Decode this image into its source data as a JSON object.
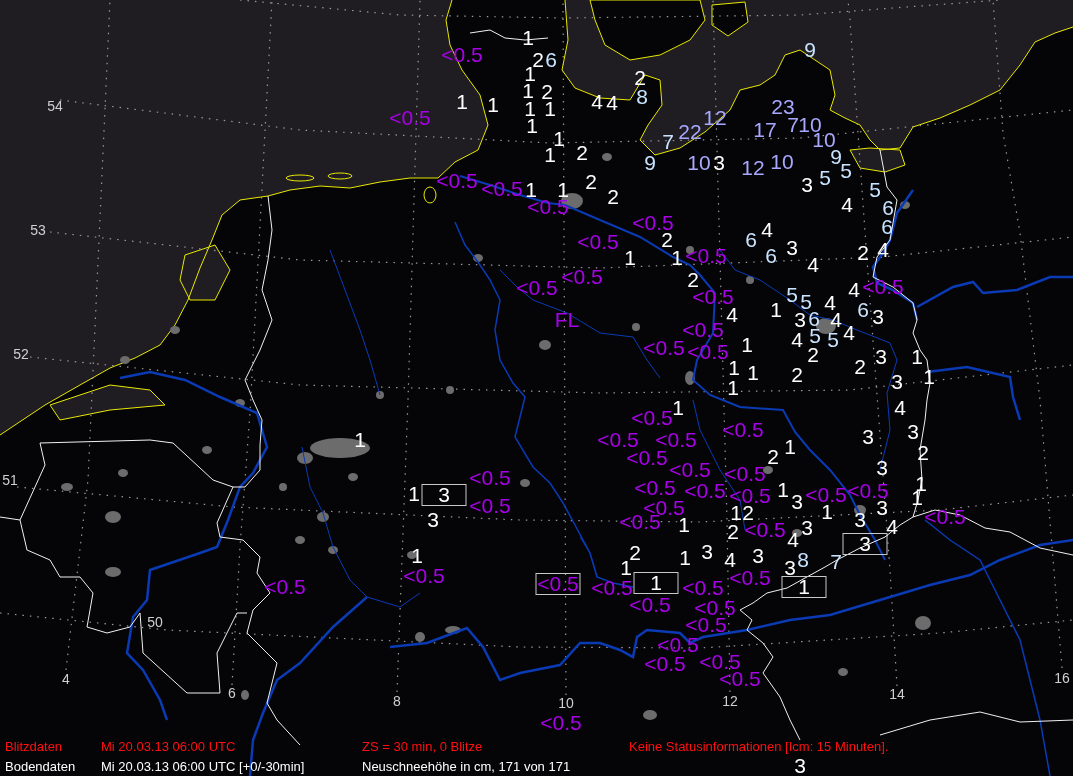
{
  "map": {
    "latitude_labels": [
      "54",
      "53",
      "52",
      "51",
      "50"
    ],
    "longitude_labels": [
      "4",
      "6",
      "8",
      "10",
      "12",
      "14",
      "16"
    ],
    "marker": "FL",
    "stations": [
      {
        "text": "1",
        "color": "#ffffff",
        "boxed": false
      },
      {
        "text": "<0.5",
        "color": "#a800e8",
        "boxed": false
      },
      {
        "text": "2",
        "color": "#ffffff",
        "boxed": false
      },
      {
        "text": "6",
        "color": "#c8e4ff",
        "boxed": false
      },
      {
        "text": "9",
        "color": "#c8e4ff",
        "boxed": false
      },
      {
        "text": "1",
        "color": "#ffffff",
        "boxed": false
      },
      {
        "text": "2",
        "color": "#ffffff",
        "boxed": false
      },
      {
        "text": "1",
        "color": "#ffffff",
        "boxed": false
      },
      {
        "text": "2",
        "color": "#ffffff",
        "boxed": false
      },
      {
        "text": "1",
        "color": "#ffffff",
        "boxed": false
      },
      {
        "text": "1",
        "color": "#ffffff",
        "boxed": false
      },
      {
        "text": "1",
        "color": "#ffffff",
        "boxed": false
      },
      {
        "text": "1",
        "color": "#ffffff",
        "boxed": false
      },
      {
        "text": "4",
        "color": "#ffffff",
        "boxed": false
      },
      {
        "text": "4",
        "color": "#ffffff",
        "boxed": false
      },
      {
        "text": "8",
        "color": "#c8e4ff",
        "boxed": false
      },
      {
        "text": "23",
        "color": "#a8a8ff",
        "boxed": false
      },
      {
        "text": "<0.5",
        "color": "#a800e8",
        "boxed": false
      },
      {
        "text": "1",
        "color": "#ffffff",
        "boxed": false
      },
      {
        "text": "1",
        "color": "#ffffff",
        "boxed": false
      },
      {
        "text": "7",
        "color": "#c8e4ff",
        "boxed": false
      },
      {
        "text": "22",
        "color": "#a8a8ff",
        "boxed": false
      },
      {
        "text": "12",
        "color": "#a8a8ff",
        "boxed": false
      },
      {
        "text": "17",
        "color": "#a8a8ff",
        "boxed": false
      },
      {
        "text": "7",
        "color": "#a8a8ff",
        "boxed": false
      },
      {
        "text": "10",
        "color": "#a8a8ff",
        "boxed": false
      },
      {
        "text": "10",
        "color": "#a8a8ff",
        "boxed": false
      },
      {
        "text": "1",
        "color": "#ffffff",
        "boxed": false
      },
      {
        "text": "2",
        "color": "#ffffff",
        "boxed": false
      },
      {
        "text": "9",
        "color": "#c8e4ff",
        "boxed": false
      },
      {
        "text": "10",
        "color": "#a8a8ff",
        "boxed": false
      },
      {
        "text": "3",
        "color": "#ffffff",
        "boxed": false
      },
      {
        "text": "12",
        "color": "#a8a8ff",
        "boxed": false
      },
      {
        "text": "10",
        "color": "#a8a8ff",
        "boxed": false
      },
      {
        "text": "9",
        "color": "#c8e4ff",
        "boxed": false
      },
      {
        "text": "5",
        "color": "#c8e4ff",
        "boxed": false
      },
      {
        "text": "<0.5",
        "color": "#a800e8",
        "boxed": false
      },
      {
        "text": "<0.5",
        "color": "#a800e8",
        "boxed": false
      },
      {
        "text": "1",
        "color": "#ffffff",
        "boxed": false
      },
      {
        "text": "1",
        "color": "#ffffff",
        "boxed": false
      },
      {
        "text": "2",
        "color": "#ffffff",
        "boxed": false
      },
      {
        "text": "3",
        "color": "#ffffff",
        "boxed": false
      },
      {
        "text": "5",
        "color": "#c8e4ff",
        "boxed": false
      },
      {
        "text": "5",
        "color": "#c8e4ff",
        "boxed": false
      },
      {
        "text": "<0.5",
        "color": "#a800e8",
        "boxed": false
      },
      {
        "text": "2",
        "color": "#ffffff",
        "boxed": false
      },
      {
        "text": "4",
        "color": "#ffffff",
        "boxed": false
      },
      {
        "text": "6",
        "color": "#c8e4ff",
        "boxed": false
      },
      {
        "text": "<0.5",
        "color": "#a800e8",
        "boxed": false
      },
      {
        "text": "4",
        "color": "#ffffff",
        "boxed": false
      },
      {
        "text": "6",
        "color": "#c8e4ff",
        "boxed": false
      },
      {
        "text": "<0.5",
        "color": "#a800e8",
        "boxed": false
      },
      {
        "text": "1",
        "color": "#ffffff",
        "boxed": false
      },
      {
        "text": "2",
        "color": "#ffffff",
        "boxed": false
      },
      {
        "text": "1",
        "color": "#ffffff",
        "boxed": false
      },
      {
        "text": "<0.5",
        "color": "#a800e8",
        "boxed": false
      },
      {
        "text": "6",
        "color": "#c8e4ff",
        "boxed": false
      },
      {
        "text": "6",
        "color": "#c8e4ff",
        "boxed": false
      },
      {
        "text": "3",
        "color": "#ffffff",
        "boxed": false
      },
      {
        "text": "2",
        "color": "#ffffff",
        "boxed": false
      },
      {
        "text": "4",
        "color": "#ffffff",
        "boxed": false
      },
      {
        "text": "4",
        "color": "#ffffff",
        "boxed": false
      },
      {
        "text": "<0.5",
        "color": "#a800e8",
        "boxed": false
      },
      {
        "text": "<0.5",
        "color": "#a800e8",
        "boxed": false
      },
      {
        "text": "2",
        "color": "#ffffff",
        "boxed": false
      },
      {
        "text": "4",
        "color": "#ffffff",
        "boxed": false
      },
      {
        "text": "<0.5",
        "color": "#a800e8",
        "boxed": false
      },
      {
        "text": "<0.5",
        "color": "#a800e8",
        "boxed": false
      },
      {
        "text": "4",
        "color": "#ffffff",
        "boxed": false
      },
      {
        "text": "1",
        "color": "#ffffff",
        "boxed": false
      },
      {
        "text": "5",
        "color": "#c8e4ff",
        "boxed": false
      },
      {
        "text": "3",
        "color": "#ffffff",
        "boxed": false
      },
      {
        "text": "5",
        "color": "#c8e4ff",
        "boxed": false
      },
      {
        "text": "6",
        "color": "#c8e4ff",
        "boxed": false
      },
      {
        "text": "4",
        "color": "#ffffff",
        "boxed": false
      },
      {
        "text": "4",
        "color": "#ffffff",
        "boxed": false
      },
      {
        "text": "6",
        "color": "#c8e4ff",
        "boxed": false
      },
      {
        "text": "3",
        "color": "#ffffff",
        "boxed": false
      },
      {
        "text": "<0.5",
        "color": "#a800e8",
        "boxed": false
      },
      {
        "text": "<0.5",
        "color": "#a800e8",
        "boxed": false
      },
      {
        "text": "1",
        "color": "#ffffff",
        "boxed": false
      },
      {
        "text": "4",
        "color": "#ffffff",
        "boxed": false
      },
      {
        "text": "5",
        "color": "#c8e4ff",
        "boxed": false
      },
      {
        "text": "5",
        "color": "#c8e4ff",
        "boxed": false
      },
      {
        "text": "4",
        "color": "#ffffff",
        "boxed": false
      },
      {
        "text": "<0.5",
        "color": "#a800e8",
        "boxed": false
      },
      {
        "text": "2",
        "color": "#ffffff",
        "boxed": false
      },
      {
        "text": "3",
        "color": "#ffffff",
        "boxed": false
      },
      {
        "text": "1",
        "color": "#ffffff",
        "boxed": false
      },
      {
        "text": "1",
        "color": "#ffffff",
        "boxed": false
      },
      {
        "text": "1",
        "color": "#ffffff",
        "boxed": false
      },
      {
        "text": "2",
        "color": "#ffffff",
        "boxed": false
      },
      {
        "text": "2",
        "color": "#ffffff",
        "boxed": false
      },
      {
        "text": "1",
        "color": "#ffffff",
        "boxed": false
      },
      {
        "text": "1",
        "color": "#ffffff",
        "boxed": false
      },
      {
        "text": "3",
        "color": "#ffffff",
        "boxed": false
      },
      {
        "text": "1",
        "color": "#ffffff",
        "boxed": false
      },
      {
        "text": "4",
        "color": "#ffffff",
        "boxed": false
      },
      {
        "text": "<0.5",
        "color": "#a800e8",
        "boxed": false
      },
      {
        "text": "1",
        "color": "#ffffff",
        "boxed": false
      },
      {
        "text": "<0.5",
        "color": "#a800e8",
        "boxed": false
      },
      {
        "text": "<0.5",
        "color": "#a800e8",
        "boxed": false
      },
      {
        "text": "<0.5",
        "color": "#a800e8",
        "boxed": false
      },
      {
        "text": "3",
        "color": "#ffffff",
        "boxed": false
      },
      {
        "text": "3",
        "color": "#ffffff",
        "boxed": false
      },
      {
        "text": "<0.5",
        "color": "#a800e8",
        "boxed": false
      },
      {
        "text": "2",
        "color": "#ffffff",
        "boxed": false
      },
      {
        "text": "1",
        "color": "#ffffff",
        "boxed": false
      },
      {
        "text": "2",
        "color": "#ffffff",
        "boxed": false
      },
      {
        "text": "<0.5",
        "color": "#a800e8",
        "boxed": false
      },
      {
        "text": "3",
        "color": "#ffffff",
        "boxed": false
      },
      {
        "text": "<0.5",
        "color": "#a800e8",
        "boxed": false
      },
      {
        "text": "<0.5",
        "color": "#a800e8",
        "boxed": false
      },
      {
        "text": "1",
        "color": "#ffffff",
        "boxed": false
      },
      {
        "text": "1",
        "color": "#ffffff",
        "boxed": false
      },
      {
        "text": "3",
        "color": "#ffffff",
        "boxed": true
      },
      {
        "text": "<0.5",
        "color": "#a800e8",
        "boxed": false
      },
      {
        "text": "<0.5",
        "color": "#a800e8",
        "boxed": false
      },
      {
        "text": "<0.5",
        "color": "#a800e8",
        "boxed": false
      },
      {
        "text": "<0.5",
        "color": "#a800e8",
        "boxed": false
      },
      {
        "text": "<0.5",
        "color": "#a800e8",
        "boxed": false
      },
      {
        "text": "1",
        "color": "#ffffff",
        "boxed": false
      },
      {
        "text": "2",
        "color": "#ffffff",
        "boxed": false
      },
      {
        "text": "1",
        "color": "#ffffff",
        "boxed": false
      },
      {
        "text": "3",
        "color": "#ffffff",
        "boxed": false
      },
      {
        "text": "<0.5",
        "color": "#a800e8",
        "boxed": false
      },
      {
        "text": "1",
        "color": "#ffffff",
        "boxed": false
      },
      {
        "text": "<0.5",
        "color": "#a800e8",
        "boxed": false
      },
      {
        "text": "3",
        "color": "#ffffff",
        "boxed": false
      },
      {
        "text": "1",
        "color": "#ffffff",
        "boxed": false
      },
      {
        "text": "3",
        "color": "#ffffff",
        "boxed": false
      },
      {
        "text": "<0.5",
        "color": "#a800e8",
        "boxed": false
      },
      {
        "text": "1",
        "color": "#ffffff",
        "boxed": false
      },
      {
        "text": "3",
        "color": "#ffffff",
        "boxed": false
      },
      {
        "text": "<0.5",
        "color": "#a800e8",
        "boxed": false
      },
      {
        "text": "2",
        "color": "#ffffff",
        "boxed": false
      },
      {
        "text": "<0.5",
        "color": "#a800e8",
        "boxed": false
      },
      {
        "text": "3",
        "color": "#ffffff",
        "boxed": false
      },
      {
        "text": "4",
        "color": "#ffffff",
        "boxed": false
      },
      {
        "text": "4",
        "color": "#ffffff",
        "boxed": false
      },
      {
        "text": "3",
        "color": "#ffffff",
        "boxed": true
      },
      {
        "text": "1",
        "color": "#ffffff",
        "boxed": false
      },
      {
        "text": "2",
        "color": "#ffffff",
        "boxed": false
      },
      {
        "text": "1",
        "color": "#ffffff",
        "boxed": false
      },
      {
        "text": "3",
        "color": "#ffffff",
        "boxed": false
      },
      {
        "text": "4",
        "color": "#ffffff",
        "boxed": false
      },
      {
        "text": "3",
        "color": "#ffffff",
        "boxed": false
      },
      {
        "text": "8",
        "color": "#c8e4ff",
        "boxed": false
      },
      {
        "text": "7",
        "color": "#c8e4ff",
        "boxed": false
      },
      {
        "text": "<0.5",
        "color": "#a800e8",
        "boxed": false
      },
      {
        "text": "1",
        "color": "#ffffff",
        "boxed": false
      },
      {
        "text": "<0.5",
        "color": "#a800e8",
        "boxed": false
      },
      {
        "text": "3",
        "color": "#ffffff",
        "boxed": false
      },
      {
        "text": "<0.5",
        "color": "#a800e8",
        "boxed": false
      },
      {
        "text": "<0.5",
        "color": "#a800e8",
        "boxed": true
      },
      {
        "text": "<0.5",
        "color": "#a800e8",
        "boxed": false
      },
      {
        "text": "1",
        "color": "#ffffff",
        "boxed": true
      },
      {
        "text": "<0.5",
        "color": "#a800e8",
        "boxed": false
      },
      {
        "text": "1",
        "color": "#ffffff",
        "boxed": true
      },
      {
        "text": "<0.5",
        "color": "#a800e8",
        "boxed": false
      },
      {
        "text": "<0.5",
        "color": "#a800e8",
        "boxed": false
      },
      {
        "text": "<0.5",
        "color": "#a800e8",
        "boxed": false
      },
      {
        "text": "<0.5",
        "color": "#a800e8",
        "boxed": false
      },
      {
        "text": "<0.5",
        "color": "#a800e8",
        "boxed": false
      },
      {
        "text": "<0.5",
        "color": "#a800e8",
        "boxed": false
      },
      {
        "text": "<0.5",
        "color": "#a800e8",
        "boxed": false
      },
      {
        "text": "<0.5",
        "color": "#a800e8",
        "boxed": false
      },
      {
        "text": "3",
        "color": "#ffffff",
        "boxed": false
      }
    ]
  },
  "status_bar": {
    "lightning": {
      "source": "Blitzdaten",
      "time": "Mi 20.03.13 06:00 UTC",
      "interval": "ZS = 30 min, 0 Blitze",
      "status": "Keine Statusinformationen [Icm: 15 Minuten]."
    },
    "surface": {
      "source": "Bodendaten",
      "time": "Mi 20.03.13 06:00 UTC [+0/-30min]",
      "parameter": "Neuschneehöhe in cm, 171 von 171"
    }
  }
}
